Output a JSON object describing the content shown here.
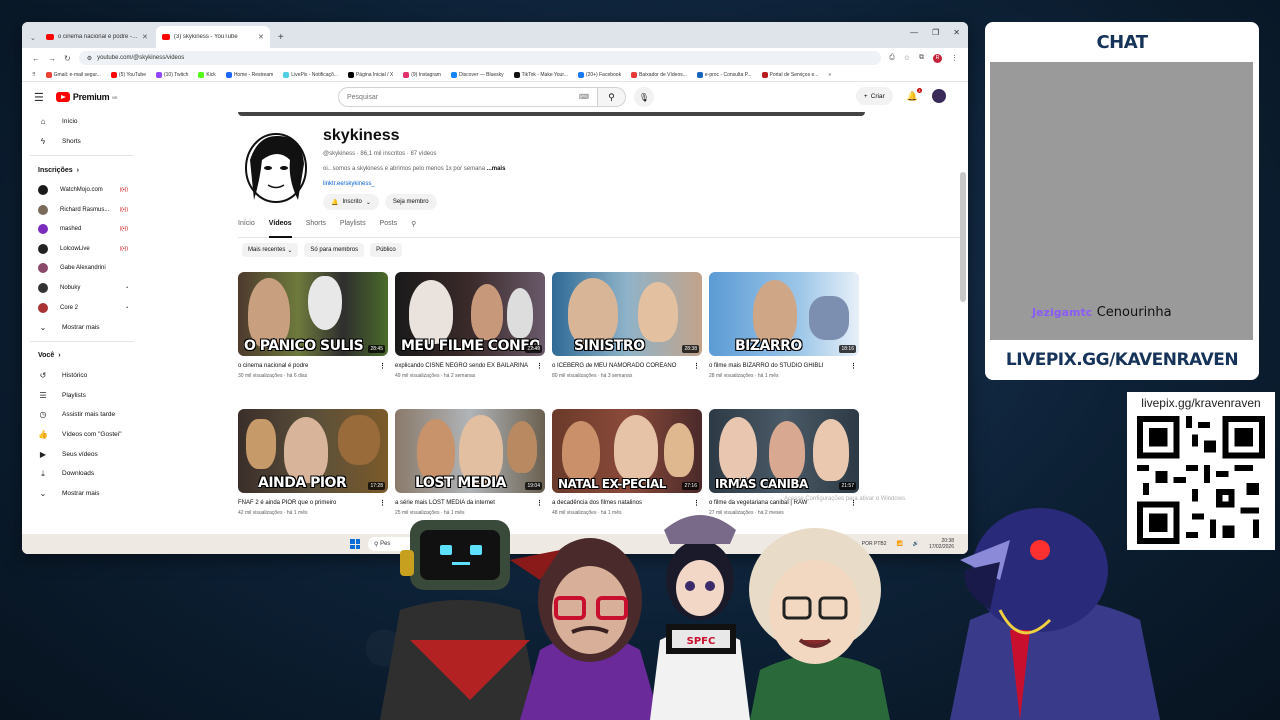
{
  "browser": {
    "tabs": [
      {
        "label": "o cinema nacional é podre - Yo",
        "active": false
      },
      {
        "label": "(3) skykiness - YouTube",
        "active": true
      }
    ],
    "url": "youtube.com/@skykiness/videos",
    "bookmarks": [
      "Gmail: e-mail segur...",
      "(5) YouTube",
      "(10) Twitch",
      "Kick",
      "Home - Restream",
      "LivePix - Notificaçõ...",
      "Página Inicial / X",
      "(9) Instagram",
      "Discover — Bluesky",
      "TikTok - Make Your...",
      "(20+) Facebook",
      "Baixador de Vídeos...",
      "e-proc - Consulta P...",
      "Portal de Serviços e..."
    ]
  },
  "youtube": {
    "logo_text": "Premium",
    "logo_sup": "BR",
    "search_placeholder": "Pesquisar",
    "create_label": "Criar",
    "notif_count": "3",
    "sidebar": {
      "home": "Início",
      "shorts": "Shorts",
      "subs_header": "Inscrições",
      "subs": [
        "WatchMojo.com",
        "Richard Rasmus...",
        "mashed",
        "LolcowLive",
        "Gabe Alexandrini",
        "Nobuky",
        "Core 2"
      ],
      "show_more": "Mostrar mais",
      "you_header": "Você",
      "you_items": [
        "Histórico",
        "Playlists",
        "Assistir mais tarde",
        "Vídeos com \"Gostei\"",
        "Seus vídeos",
        "Downloads",
        "Mostrar mais"
      ]
    },
    "channel": {
      "name": "skykiness",
      "meta": "@skykiness · 86,1 mil inscritos · 87 vídeos",
      "desc": "oi.. somos a skykiness e abrimos pelo menos 1x por semana ",
      "desc_more": "...mais",
      "link": "linktr.ee/skykiness_",
      "subscribed": "Inscrito",
      "join": "Seja membro",
      "tabs": [
        "Início",
        "Vídeos",
        "Shorts",
        "Playlists",
        "Posts"
      ],
      "filters": [
        "Mais recentes",
        "Só para membros",
        "Público"
      ]
    },
    "videos": [
      {
        "overlay": "O PÂNICO SULIS",
        "duration": "28:45",
        "title": "o cinema nacional é podre",
        "meta": "30 mil visualizações · há 6 dias",
        "bg": "#6d7a3c"
      },
      {
        "overlay": "MEU FILME CONFOR",
        "duration": "22:49",
        "title": "explicando CISNE NEGRO sendo EX BAILARINA",
        "meta": "49 mil visualizações · há 2 semanas",
        "bg": "#3b2a2a"
      },
      {
        "overlay": "SINISTRO",
        "duration": "28:38",
        "title": "o ICEBERG de MEU NAMORADO COREANO",
        "meta": "80 mil visualizações · há 3 semanas",
        "bg": "#4a8fb4"
      },
      {
        "overlay": "BIZARRO",
        "duration": "18:16",
        "title": "o filme mais BIZARRO do STUDIO GHIBLI",
        "meta": "28 mil visualizações · há 1 mês",
        "bg": "#6aa8d8"
      },
      {
        "overlay": "AINDA PIOR",
        "duration": "17:28",
        "title": "FNAF 2 é ainda PIOR que o primeiro",
        "meta": "42 mil visualizações · há 1 mês",
        "bg": "#5a4f3a"
      },
      {
        "overlay": "LOST MEDIA",
        "duration": "19:04",
        "title": "a série mais LOST MEDIA da internet",
        "meta": "25 mil visualizações · há 1 mês",
        "bg": "#8a8c8f"
      },
      {
        "overlay": "NATAL EX-PECIAL",
        "duration": "27:16",
        "title": "a decadência dos filmes natalinos",
        "meta": "48 mil visualizações · há 1 mês",
        "bg": "#7a3a2a"
      },
      {
        "overlay": "IRMÃS CANIBA",
        "duration": "21:57",
        "title": "o filme da vegetariana canibal | RAW",
        "meta": "27 mil visualizações · há 2 meses",
        "bg": "#2d3a45"
      }
    ],
    "watermark": "Acesse Configurações para ativar o Windows."
  },
  "taskbar": {
    "search": "Pes",
    "lang": "POR PTB2",
    "time": "20:38",
    "date": "17/02/2026"
  },
  "chat": {
    "title": "CHAT",
    "user": "Jezigamtc",
    "message": "Cenourinha",
    "footer": "LIVEPIX.GG/KAVENRAVEN"
  },
  "qr": {
    "label": "livepix.gg/kravenraven"
  },
  "colors": {
    "accent_navy": "#16335a",
    "youtube_red": "#ff0000",
    "chat_user": "#8b5cf6"
  }
}
